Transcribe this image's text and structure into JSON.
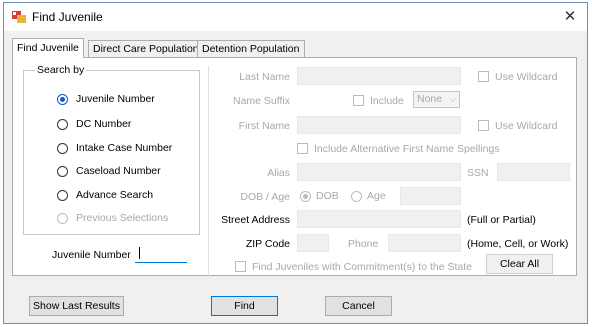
{
  "window": {
    "title": "Find Juvenile",
    "close_glyph": "✕"
  },
  "tabs": [
    {
      "label": "Find Juvenile",
      "active": true
    },
    {
      "label": "Direct Care Population",
      "active": false
    },
    {
      "label": "Detention Population",
      "active": false
    }
  ],
  "search_by": {
    "label": "Search by",
    "options": [
      {
        "label": "Juvenile Number",
        "checked": true,
        "enabled": true
      },
      {
        "label": "DC Number",
        "checked": false,
        "enabled": true
      },
      {
        "label": "Intake Case Number",
        "checked": false,
        "enabled": true
      },
      {
        "label": "Caseload Number",
        "checked": false,
        "enabled": true
      },
      {
        "label": "Advance Search",
        "checked": false,
        "enabled": true
      },
      {
        "label": "Previous Selections",
        "checked": false,
        "enabled": false
      }
    ]
  },
  "juvenile_number": {
    "label": "Juvenile Number",
    "value": ""
  },
  "form": {
    "last_name_label": "Last Name",
    "use_wildcard_label": "Use Wildcard",
    "name_suffix_label": "Name Suffix",
    "include_label": "Include",
    "suffix_value": "None",
    "first_name_label": "First Name",
    "include_alt_label": "Include Alternative First Name Spellings",
    "alias_label": "Alias",
    "ssn_label": "SSN",
    "dob_age_label": "DOB / Age",
    "dob_label": "DOB",
    "age_label": "Age",
    "street_address_label": "Street Address",
    "full_or_partial": "(Full or Partial)",
    "zip_label": "ZIP Code",
    "phone_label": "Phone",
    "phone_hint": "(Home, Cell, or Work)",
    "commitment_label": "Find Juveniles with Commitment(s) to the State",
    "clear_all": "Clear All"
  },
  "footer": {
    "show_last_results": "Show Last Results",
    "find": "Find",
    "cancel": "Cancel"
  },
  "colors": {
    "accent": "#0f58c9",
    "disabled_text": "#a8a8a8",
    "focus_border": "#0078d7"
  }
}
